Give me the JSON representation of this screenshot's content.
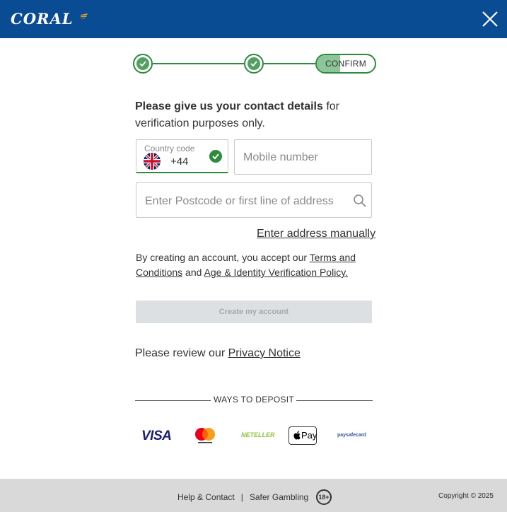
{
  "header": {
    "logo": "CORAL",
    "close_icon": "close-icon"
  },
  "stepper": {
    "steps": [
      "done",
      "done",
      "CONFIRM"
    ],
    "confirm_label": "CONFIRM",
    "confirm_progress": 0.4,
    "accent_color": "#2e8b3d"
  },
  "intro": {
    "bold": "Please give us your contact details",
    "rest": " for verification purposes only."
  },
  "country": {
    "label": "Country code",
    "value": "+44",
    "flag_icon": "uk-flag-icon"
  },
  "mobile": {
    "placeholder": "Mobile number"
  },
  "address": {
    "placeholder": "Enter Postcode or first line of address",
    "icon": "search-icon"
  },
  "manual_link": "Enter address manually",
  "terms": {
    "prefix": "By creating an account, you accept our ",
    "link1": "Terms and Conditions",
    "middle": " and ",
    "link2": "Age & Identity Verification Policy."
  },
  "create_button": "Create my account",
  "privacy": {
    "prefix": "Please review our ",
    "link": "Privacy Notice"
  },
  "deposit": {
    "heading": "WAYS TO DEPOSIT",
    "methods": {
      "visa": "VISA",
      "neteller": "NETELLER",
      "apple_pay": "Pay",
      "paysafecard": "paysafecard"
    }
  },
  "footer": {
    "help": "Help & Contact",
    "separator": "|",
    "safer": "Safer Gambling",
    "age": "18+",
    "copyright": "Copyright © 2025"
  },
  "colors": {
    "header_bg": "#0a4c93",
    "accent": "#2e8b3d",
    "footer_bg": "#d9d9d9"
  }
}
